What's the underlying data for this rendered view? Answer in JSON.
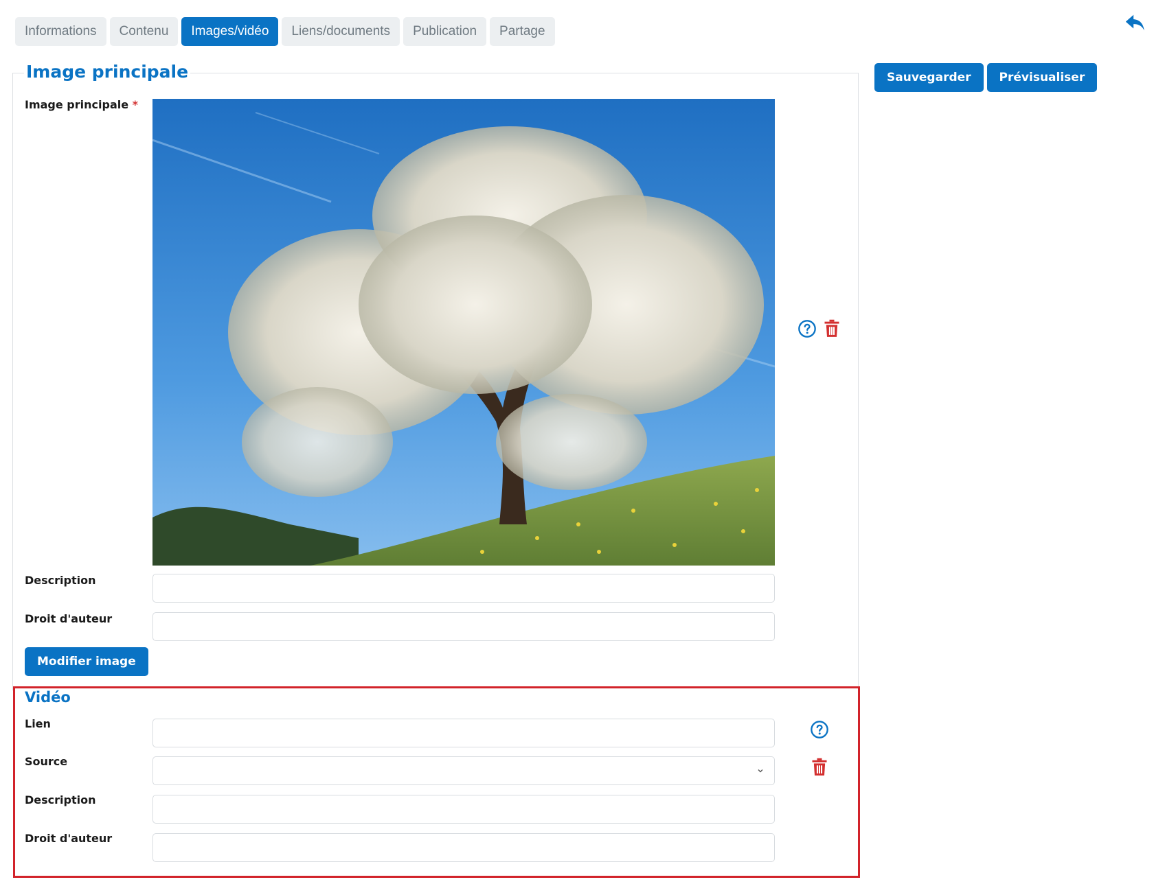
{
  "tabs": [
    {
      "label": "Informations",
      "active": false
    },
    {
      "label": "Contenu",
      "active": false
    },
    {
      "label": "Images/vidéo",
      "active": true
    },
    {
      "label": "Liens/documents",
      "active": false
    },
    {
      "label": "Publication",
      "active": false
    },
    {
      "label": "Partage",
      "active": false
    }
  ],
  "actions": {
    "save_label": "Sauvegarder",
    "preview_label": "Prévisualiser"
  },
  "main_image": {
    "section_title": "Image principale",
    "field_label": "Image principale",
    "required_mark": "*",
    "description_label": "Description",
    "description_value": "",
    "copyright_label": "Droit d'auteur",
    "copyright_value": "",
    "modify_label": "Modifier image"
  },
  "video": {
    "title": "Vidéo",
    "link_label": "Lien",
    "link_value": "",
    "source_label": "Source",
    "source_value": "",
    "description_label": "Description",
    "description_value": "",
    "copyright_label": "Droit d'auteur",
    "copyright_value": ""
  },
  "icons": {
    "back": "reply-arrow-icon",
    "help": "question-circle-icon",
    "delete": "trash-icon",
    "select": "chevron-down-icon"
  },
  "colors": {
    "primary": "#0a73c4",
    "danger": "#d32f2f",
    "highlight": "#d2232a"
  }
}
